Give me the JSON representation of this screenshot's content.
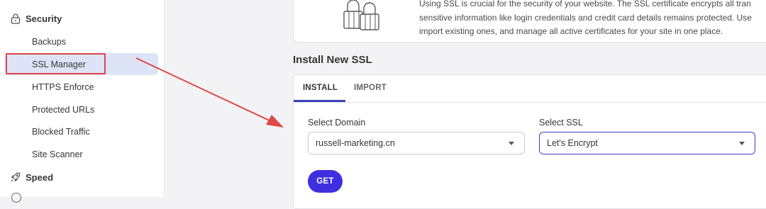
{
  "sidebar": {
    "security_heading": "Security",
    "speed_heading": "Speed",
    "items": [
      {
        "label": "Backups"
      },
      {
        "label": "SSL Manager",
        "active": true
      },
      {
        "label": "HTTPS Enforce"
      },
      {
        "label": "Protected URLs"
      },
      {
        "label": "Blocked Traffic"
      },
      {
        "label": "Site Scanner"
      }
    ],
    "icons": {
      "security": "lock-icon",
      "speed": "rocket-icon"
    }
  },
  "info_card": {
    "lines": [
      "Using SSL is crucial for the security of your website. The SSL certificate encrypts all tran",
      "sensitive information like login credentials and credit card details remains protected. Use",
      "import existing ones, and manage all active certificates for your site in one place."
    ],
    "illustration": "padlocks-illustration"
  },
  "install": {
    "title": "Install New SSL",
    "tabs": [
      {
        "label": "INSTALL",
        "active": true
      },
      {
        "label": "IMPORT",
        "active": false
      }
    ],
    "domain_label": "Select Domain",
    "domain_value": "russell-marketing.cn",
    "ssl_label": "Select SSL",
    "ssl_value": "Let's Encrypt",
    "get_button": "GET"
  },
  "colors": {
    "accent": "#3b43b8",
    "button": "#3d2fe0",
    "annotation_red": "#e04747",
    "active_item_bg": "#dde4f7"
  }
}
